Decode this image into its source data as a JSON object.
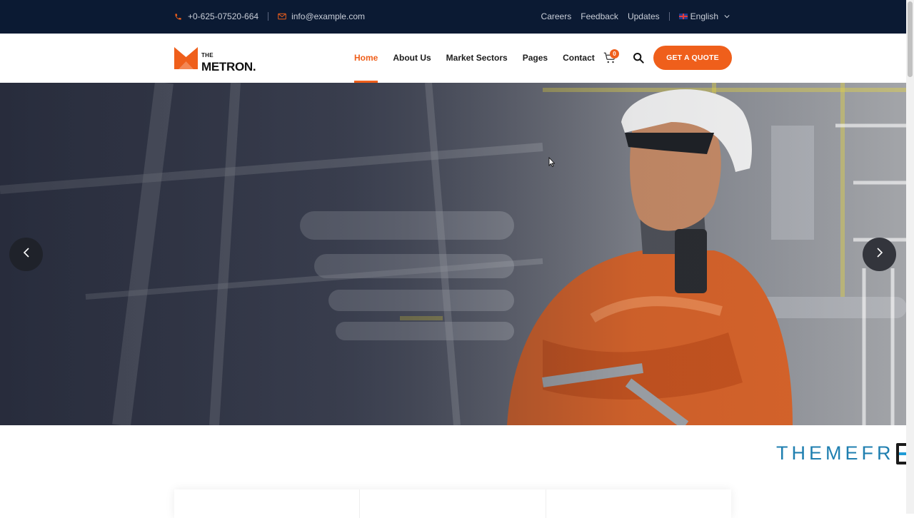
{
  "topbar": {
    "phone": "+0-625-07520-664",
    "email": "info@example.com",
    "links": [
      "Careers",
      "Feedback",
      "Updates"
    ],
    "language": "English"
  },
  "header": {
    "logo_small": "THE",
    "logo_big": "METRON.",
    "nav": [
      "Home",
      "About Us",
      "Market Sectors",
      "Pages",
      "Contact"
    ],
    "active_nav": "Home",
    "cart_count": "0",
    "quote_button": "GET A QUOTE"
  },
  "hero": {
    "prev_icon": "chevron-left-icon",
    "next_icon": "chevron-right-icon"
  },
  "brand": {
    "text": "THEMEFR"
  },
  "colors": {
    "accent": "#ef5f1b",
    "topbar": "#0b1a33"
  }
}
